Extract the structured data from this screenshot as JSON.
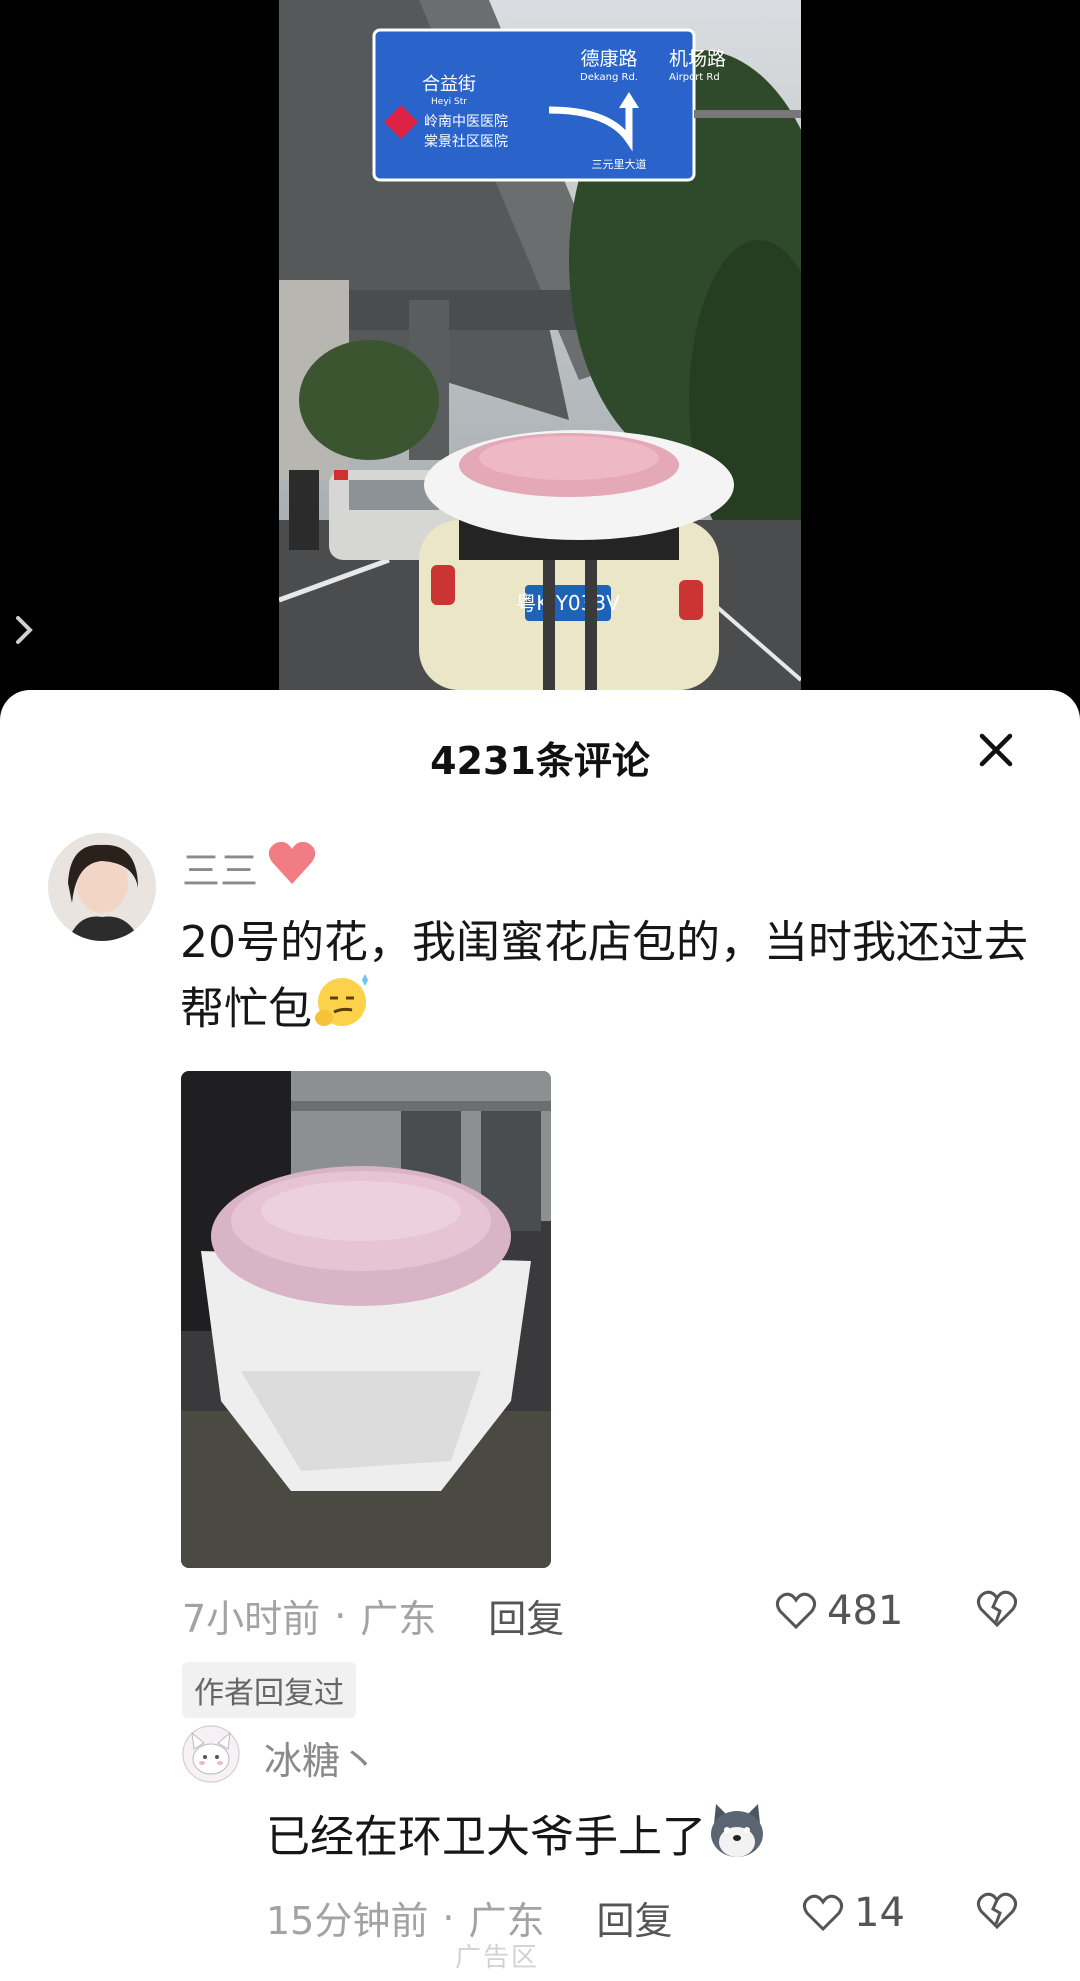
{
  "header": {
    "title": "4231条评论",
    "close_icon": "close-icon"
  },
  "video": {
    "sign_roads": [
      "德康路",
      "机场路"
    ],
    "sign_roads_en": [
      "Dekang Rd.",
      "Airport Rd"
    ],
    "sign_street": "合益街",
    "sign_street_en": "Heyi Str",
    "sign_hospital_1": "岭南中医医院",
    "sign_hospital_2": "棠景社区医院",
    "sign_bottom": "三元里大道",
    "plate": "粤K·Y033V",
    "colors": {
      "sign_blue": "#2a63c9",
      "car_cream": "#ece6c8"
    }
  },
  "comments": [
    {
      "user": "三三",
      "user_emoji": "heart-emoji",
      "text": "20号的花，我闺蜜花店包的，当时我还过去帮忙包",
      "text_emoji": "smirk-emoji",
      "time": "7小时前",
      "location": "广东",
      "reply_label": "回复",
      "likes": "481",
      "badge": "作者回复过"
    },
    {
      "user": "冰糖丶",
      "text": "已经在环卫大爷手上了",
      "text_emoji": "doge-emoji",
      "time": "15分钟前",
      "location": "广东",
      "reply_label": "回复",
      "likes": "14"
    }
  ],
  "separator": "·",
  "watermark": "广告区"
}
